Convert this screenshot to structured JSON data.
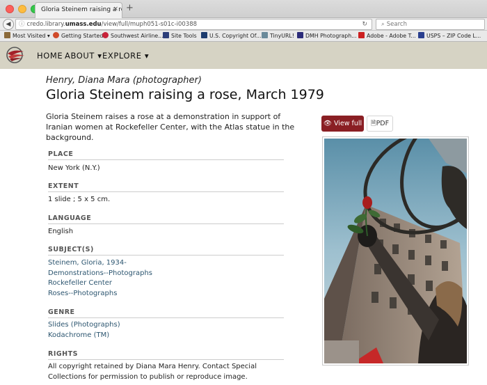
{
  "browser": {
    "tab_title": "Gloria Steinem raising a rose, ...",
    "tab_close": "×",
    "new_tab": "+",
    "url_plain": "credo.library.",
    "url_domain": "umass.edu",
    "url_rest": "/view/full/muph051-s01c-i00388",
    "search_placeholder": "Search",
    "bookmarks": [
      {
        "label": "Most Visited ▾",
        "color": "#8b6a3a"
      },
      {
        "label": "Getting Started",
        "color": "#d04a2a"
      },
      {
        "label": "Southwest Airline...",
        "color": "#c8233a"
      },
      {
        "label": "Site Tools",
        "color": "#2c3e7a"
      },
      {
        "label": "U.S. Copyright Of...",
        "color": "#1d3c6e"
      },
      {
        "label": "TinyURL!",
        "color": "#6a8a9a"
      },
      {
        "label": "DMH Photograph...",
        "color": "#2c2c7a"
      },
      {
        "label": "Adobe - Adobe T...",
        "color": "#cc1f1f"
      },
      {
        "label": "USPS – ZIP Code L...",
        "color": "#2a3f8f"
      }
    ]
  },
  "site": {
    "nav": [
      {
        "label": "HOME"
      },
      {
        "label": "ABOUT ▾"
      },
      {
        "label": "EXPLORE ▾"
      }
    ]
  },
  "item": {
    "photographer": "Henry, Diana Mara (photographer)",
    "title": "Gloria Steinem raising a rose, March 1979",
    "description": "Gloria Steinem raises a rose at a demonstration in support of Iranian women at Rockefeller Center, with the Atlas statue in the background.",
    "view_full_label": "View full",
    "pdf_label": "PDF"
  },
  "fields": {
    "place": {
      "label": "PLACE",
      "values": [
        "New York (N.Y.)"
      ]
    },
    "extent": {
      "label": "EXTENT",
      "values": [
        "1 slide ; 5 x 5 cm."
      ]
    },
    "language": {
      "label": "LANGUAGE",
      "values": [
        "English"
      ]
    },
    "subjects": {
      "label": "SUBJECT(S)",
      "values": [
        "Steinem, Gloria, 1934-",
        "Demonstrations--Photographs",
        "Rockefeller Center",
        "Roses--Photographs"
      ]
    },
    "genre": {
      "label": "GENRE",
      "values": [
        "Slides (Photographs)",
        "Kodachrome (TM)"
      ]
    },
    "rights": {
      "label": "RIGHTS",
      "values": [
        "All copyright retained by Diana Mara Henry. Contact Special Collections for permission to publish or reproduce image."
      ]
    }
  },
  "colors": {
    "header_bg": "#d6d3c4",
    "accent": "#8a1f24",
    "link": "#2d5670"
  }
}
